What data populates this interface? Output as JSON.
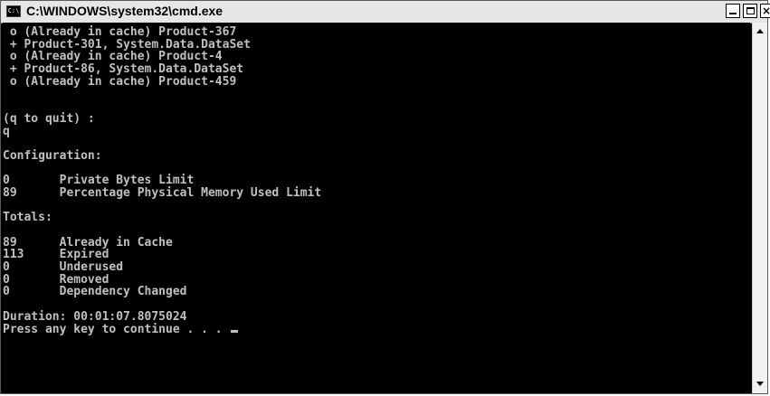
{
  "window": {
    "title": "C:\\WINDOWS\\system32\\cmd.exe",
    "icon_label": "C:\\",
    "controls": [
      "minimize",
      "maximize",
      "close"
    ]
  },
  "console": {
    "lines": [
      " o (Already in cache) Product-367",
      " + Product-301, System.Data.DataSet",
      " o (Already in cache) Product-4",
      " + Product-86, System.Data.DataSet",
      " o (Already in cache) Product-459",
      "",
      "",
      "(q to quit) :",
      "q",
      "",
      "Configuration:",
      "",
      "0       Private Bytes Limit",
      "89      Percentage Physical Memory Used Limit",
      "",
      "Totals:",
      "",
      "89      Already in Cache",
      "113     Expired",
      "0       Underused",
      "0       Removed",
      "0       Dependency Changed",
      "",
      "Duration: 00:01:07.8075024",
      "Press any key to continue . . . "
    ]
  },
  "colors": {
    "console_bg": "#000000",
    "console_text": "#c0c0c0",
    "titlebar_bg": "#e6e6e6"
  }
}
